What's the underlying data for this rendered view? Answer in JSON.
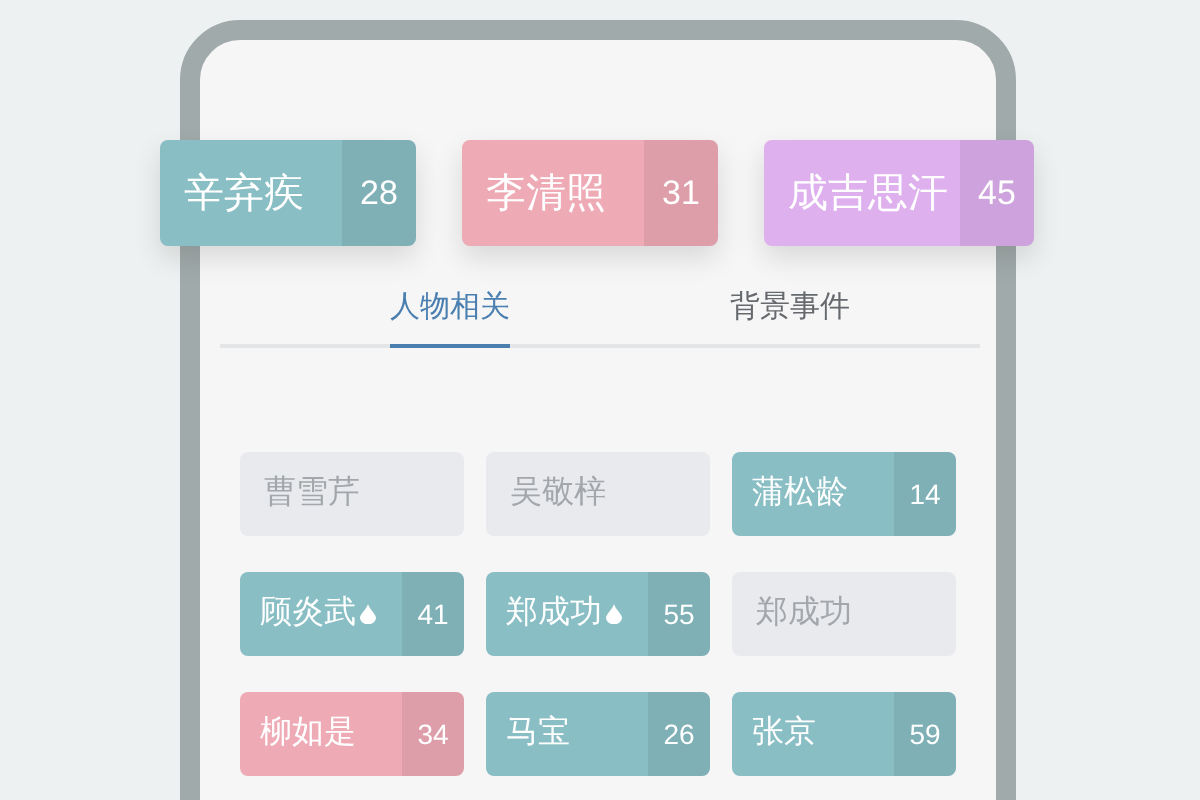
{
  "top_cards": [
    {
      "name": "辛弃疾",
      "count": "28",
      "color": "#88bec4"
    },
    {
      "name": "李清照",
      "count": "31",
      "color": "#eeabb6"
    },
    {
      "name": "成吉思汗",
      "count": "45",
      "color": "#deb0ee"
    }
  ],
  "tabs": [
    {
      "label": "人物相关",
      "selected": true
    },
    {
      "label": "背景事件",
      "selected": false
    }
  ],
  "people": [
    {
      "kind": "empty",
      "name": "曹雪芹"
    },
    {
      "kind": "empty",
      "name": "吴敬梓"
    },
    {
      "kind": "filled",
      "name": "蒲松龄",
      "count": "14",
      "color": "#88bec4",
      "hot": false
    },
    {
      "kind": "filled",
      "name": "顾炎武",
      "count": "41",
      "color": "#88bec4",
      "hot": true
    },
    {
      "kind": "filled",
      "name": "郑成功",
      "count": "55",
      "color": "#88bec4",
      "hot": true
    },
    {
      "kind": "empty",
      "name": "郑成功"
    },
    {
      "kind": "filled",
      "name": "柳如是",
      "count": "34",
      "color": "#eeabb6",
      "hot": false
    },
    {
      "kind": "filled",
      "name": "马宝",
      "count": "26",
      "color": "#88bec4",
      "hot": false
    },
    {
      "kind": "filled",
      "name": "张京",
      "count": "59",
      "color": "#88bec4",
      "hot": false
    }
  ]
}
